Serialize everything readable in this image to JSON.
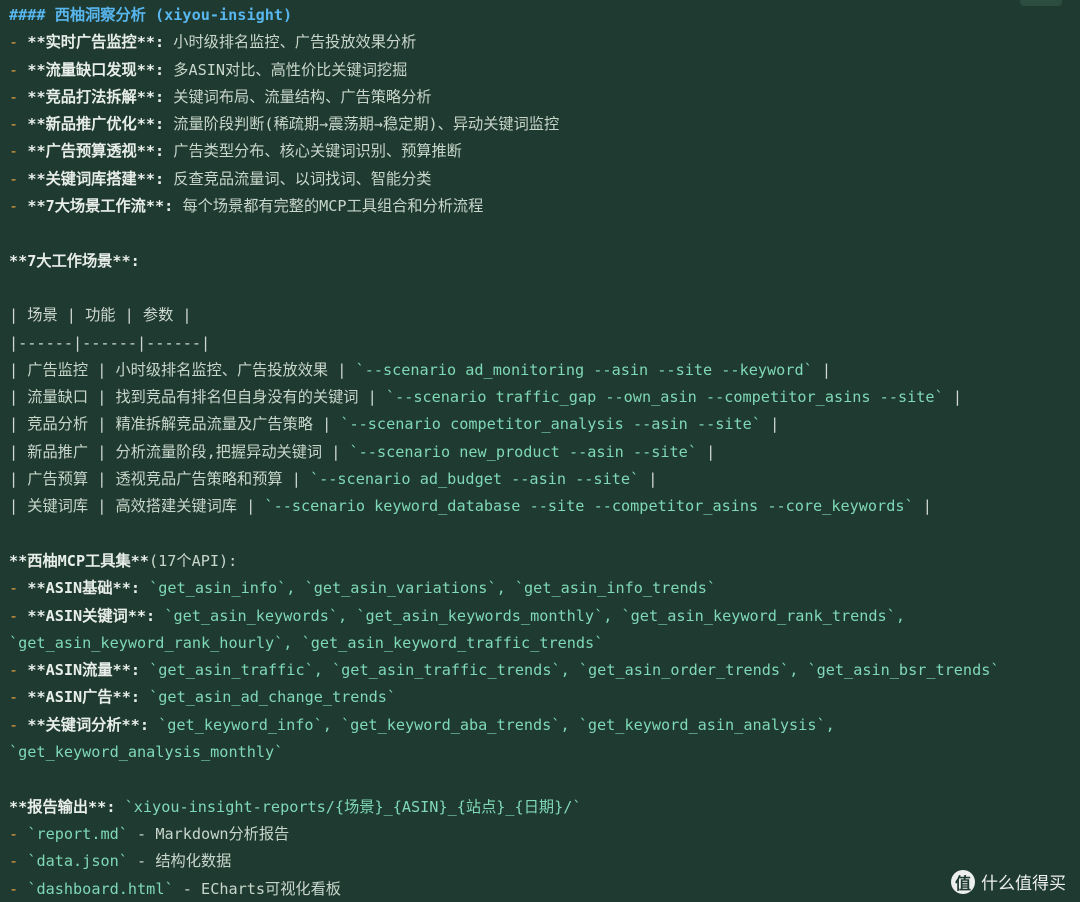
{
  "heading": {
    "marker": "####",
    "text": "西柚洞察分析 (xiyou-insight)"
  },
  "features": [
    {
      "bold": "**实时广告监控**:",
      "text": " 小时级排名监控、广告投放效果分析"
    },
    {
      "bold": "**流量缺口发现**:",
      "text": " 多ASIN对比、高性价比关键词挖掘"
    },
    {
      "bold": "**竞品打法拆解**:",
      "text": " 关键词布局、流量结构、广告策略分析"
    },
    {
      "bold": "**新品推广优化**:",
      "text": " 流量阶段判断(稀疏期→震荡期→稳定期)、异动关键词监控"
    },
    {
      "bold": "**广告预算透视**:",
      "text": " 广告类型分布、核心关键词识别、预算推断"
    },
    {
      "bold": "**关键词库搭建**:",
      "text": " 反查竞品流量词、以词找词、智能分类"
    },
    {
      "bold": "**7大场景工作流**:",
      "text": " 每个场景都有完整的MCP工具组合和分析流程"
    }
  ],
  "scenarios_title": "**7大工作场景**:",
  "table_header": "| 场景 | 功能 | 参数 |",
  "table_separator": "|------|------|------|",
  "scenario_rows": [
    {
      "name": "广告监控",
      "function": "小时级排名监控、广告投放效果",
      "param": "`--scenario ad_monitoring --asin --site --keyword`"
    },
    {
      "name": "流量缺口",
      "function": "找到竞品有排名但自身没有的关键词",
      "param": "`--scenario traffic_gap --own_asin --competitor_asins --site`"
    },
    {
      "name": "竞品分析",
      "function": "精准拆解竞品流量及广告策略",
      "param": "`--scenario competitor_analysis --asin --site`"
    },
    {
      "name": "新品推广",
      "function": "分析流量阶段,把握异动关键词",
      "param": "`--scenario new_product --asin --site`"
    },
    {
      "name": "广告预算",
      "function": "透视竞品广告策略和预算",
      "param": "`--scenario ad_budget --asin --site`"
    },
    {
      "name": "关键词库",
      "function": "高效搭建关键词库",
      "param": "`--scenario keyword_database --site --competitor_asins --core_keywords`"
    }
  ],
  "tools_title": {
    "bold": "**西柚MCP工具集**",
    "text": "(17个API):"
  },
  "tool_groups": [
    {
      "bold": "**ASIN基础**:",
      "lines": [
        "`get_asin_info`, `get_asin_variations`, `get_asin_info_trends`"
      ]
    },
    {
      "bold": "**ASIN关键词**:",
      "lines": [
        "`get_asin_keywords`, `get_asin_keywords_monthly`, `get_asin_keyword_rank_trends`,",
        "`get_asin_keyword_rank_hourly`, `get_asin_keyword_traffic_trends`"
      ]
    },
    {
      "bold": "**ASIN流量**:",
      "lines": [
        "`get_asin_traffic`, `get_asin_traffic_trends`, `get_asin_order_trends`, `get_asin_bsr_trends`"
      ]
    },
    {
      "bold": "**ASIN广告**:",
      "lines": [
        "`get_asin_ad_change_trends`"
      ]
    },
    {
      "bold": "**关键词分析**:",
      "lines": [
        "`get_keyword_info`, `get_keyword_aba_trends`, `get_keyword_asin_analysis`,",
        "`get_keyword_analysis_monthly`"
      ]
    }
  ],
  "reports": {
    "bold": "**报告输出**:",
    "path": "`xiyou-insight-reports/{场景}_{ASIN}_{站点}_{日期}/`",
    "files": [
      {
        "name": "`report.md`",
        "desc": " - Markdown分析报告"
      },
      {
        "name": "`data.json`",
        "desc": " - 结构化数据"
      },
      {
        "name": "`dashboard.html`",
        "desc": " - ECharts可视化看板"
      }
    ]
  },
  "watermark": {
    "logo": "值",
    "text": "什么值得买"
  },
  "colors": {
    "background": "#1f3a30",
    "heading": "#58b6ee",
    "bullet": "#e8a13c",
    "code": "#7fd8b8"
  }
}
